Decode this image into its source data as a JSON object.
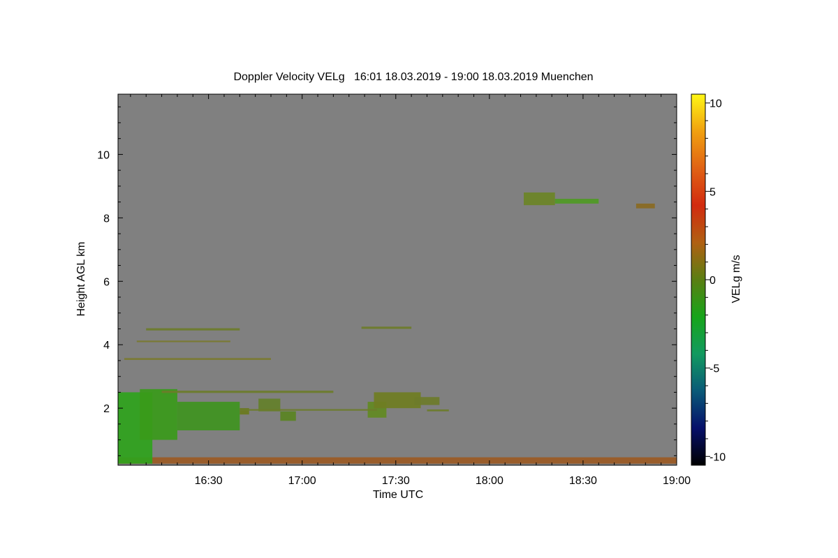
{
  "chart_data": {
    "type": "heatmap",
    "title": "Doppler Velocity VELg   16:01 18.03.2019 - 19:00 18.03.2019 Muenchen",
    "xlabel": "Time UTC",
    "ylabel": "Height AGL km",
    "x_start": "16:01",
    "x_end": "19:00",
    "xlim": [
      "16:01",
      "19:00"
    ],
    "ylim": [
      0.2,
      11.9
    ],
    "x_ticks": [
      "16:30",
      "17:00",
      "17:30",
      "18:00",
      "18:30",
      "19:00"
    ],
    "y_ticks": [
      2,
      4,
      6,
      8,
      10
    ],
    "background_value": "no signal",
    "background_color": "#808080",
    "colorbar": {
      "label": "VELg m/s",
      "range": [
        -10.5,
        10.5
      ],
      "ticks": [
        -10,
        -5,
        0,
        5,
        10
      ],
      "colors": [
        "#000000",
        "#06106a",
        "#0a5a78",
        "#129a60",
        "#17a51a",
        "#5a7e12",
        "#b06012",
        "#d22b0f",
        "#e06214",
        "#f0a010",
        "#fff715"
      ]
    },
    "features": [
      {
        "t_start": "16:01",
        "t_end": "19:00",
        "h_min": 0.25,
        "h_max": 0.45,
        "velocity": 2,
        "color": "#9b5a24"
      },
      {
        "t_start": "16:01",
        "t_end": "16:12",
        "h_min": 0.25,
        "h_max": 2.5,
        "velocity": -1.5,
        "color": "#2fa31c"
      },
      {
        "t_start": "16:08",
        "t_end": "16:20",
        "h_min": 1.0,
        "h_max": 2.6,
        "velocity": -1.5,
        "color": "#3a9a1a"
      },
      {
        "t_start": "16:20",
        "t_end": "16:40",
        "h_min": 1.3,
        "h_max": 2.2,
        "velocity": -1.2,
        "color": "#3f9420"
      },
      {
        "t_start": "16:40",
        "t_end": "16:43",
        "h_min": 1.8,
        "h_max": 2.0,
        "velocity": 0,
        "color": "#6a7a1c"
      },
      {
        "t_start": "16:46",
        "t_end": "16:53",
        "h_min": 1.9,
        "h_max": 2.3,
        "velocity": -0.5,
        "color": "#64802a"
      },
      {
        "t_start": "16:53",
        "t_end": "16:58",
        "h_min": 1.6,
        "h_max": 1.9,
        "velocity": -0.5,
        "color": "#5a8422"
      },
      {
        "t_start": "17:21",
        "t_end": "17:27",
        "h_min": 1.7,
        "h_max": 2.2,
        "velocity": -0.3,
        "color": "#628a22"
      },
      {
        "t_start": "17:23",
        "t_end": "17:38",
        "h_min": 2.0,
        "h_max": 2.5,
        "velocity": 0,
        "color": "#6f7d22"
      },
      {
        "t_start": "17:36",
        "t_end": "17:44",
        "h_min": 2.1,
        "h_max": 2.35,
        "velocity": 0,
        "color": "#6d7b2a"
      },
      {
        "t_start": "18:11",
        "t_end": "18:21",
        "h_min": 8.4,
        "h_max": 8.8,
        "velocity": -0.3,
        "color": "#6b8426"
      },
      {
        "t_start": "18:21",
        "t_end": "18:35",
        "h_min": 8.45,
        "h_max": 8.6,
        "velocity": -1,
        "color": "#4f9a24"
      },
      {
        "t_start": "18:47",
        "t_end": "18:53",
        "h_min": 8.3,
        "h_max": 8.45,
        "velocity": 1,
        "color": "#8a6a22"
      },
      {
        "t_start": "16:10",
        "t_end": "16:40",
        "h_min": 4.45,
        "h_max": 4.52,
        "velocity": 0,
        "color": "#6d7c2a"
      },
      {
        "t_start": "17:19",
        "t_end": "17:35",
        "h_min": 4.5,
        "h_max": 4.57,
        "velocity": 0,
        "color": "#6d7c2a"
      },
      {
        "t_start": "16:03",
        "t_end": "16:50",
        "h_min": 3.52,
        "h_max": 3.58,
        "velocity": 0.5,
        "color": "#7a7a30"
      },
      {
        "t_start": "16:07",
        "t_end": "16:37",
        "h_min": 4.08,
        "h_max": 4.13,
        "velocity": 0.5,
        "color": "#7a7a30"
      },
      {
        "t_start": "16:15",
        "t_end": "17:10",
        "h_min": 2.48,
        "h_max": 2.55,
        "velocity": 0,
        "color": "#6d7c2a"
      },
      {
        "t_start": "16:40",
        "t_end": "17:24",
        "h_min": 1.92,
        "h_max": 1.97,
        "velocity": 0,
        "color": "#6d7c2a"
      },
      {
        "t_start": "17:40",
        "t_end": "17:47",
        "h_min": 1.9,
        "h_max": 1.96,
        "velocity": 0,
        "color": "#6d7c2a"
      }
    ]
  }
}
